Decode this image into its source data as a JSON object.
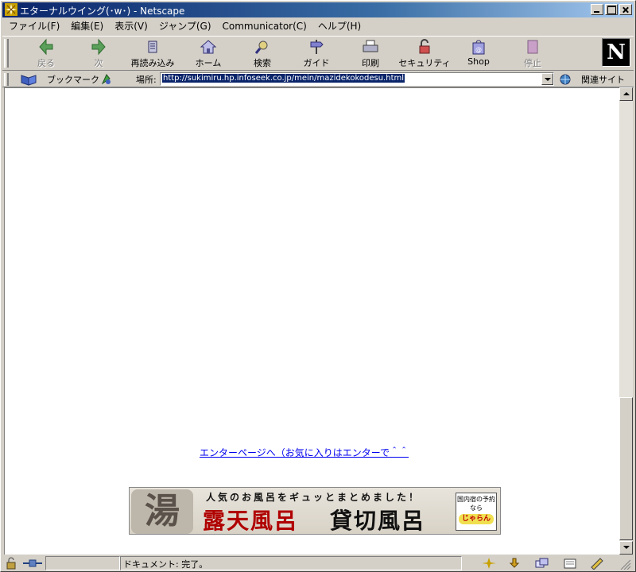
{
  "window": {
    "title": "エターナルウイング(･w･) - Netscape",
    "controls": [
      "minimize-icon",
      "maximize-icon",
      "close-icon"
    ]
  },
  "menu": {
    "file": "ファイル(F)",
    "edit": "編集(E)",
    "view": "表示(V)",
    "jump": "ジャンプ(G)",
    "communicator": "Communicator(C)",
    "help": "ヘルプ(H)"
  },
  "toolbar": {
    "back": "戻る",
    "forward": "次",
    "reload": "再読み込み",
    "home": "ホーム",
    "search": "検索",
    "guide": "ガイド",
    "print": "印刷",
    "security": "セキュリティ",
    "shop": "Shop",
    "stop": "停止",
    "logo": "N"
  },
  "location": {
    "bookmarks": "ブックマーク",
    "label": "場所:",
    "url": "http://sukimiru.hp.infoseek.co.jp/mein/mazidekokodesu.html",
    "related": "関連サイト"
  },
  "content": {
    "enter_link": "エンターページへ（お気に入りはエンターで＾＾",
    "banner": {
      "yu": "湯",
      "headline": "人気のお風呂をギュッとまとめました！",
      "title_a": "露天風呂",
      "title_b": "貸切風呂",
      "box_text": "国内宿の予約なら",
      "brand": "じゃらん"
    }
  },
  "status": {
    "text": "ドキュメント: 完了。"
  }
}
